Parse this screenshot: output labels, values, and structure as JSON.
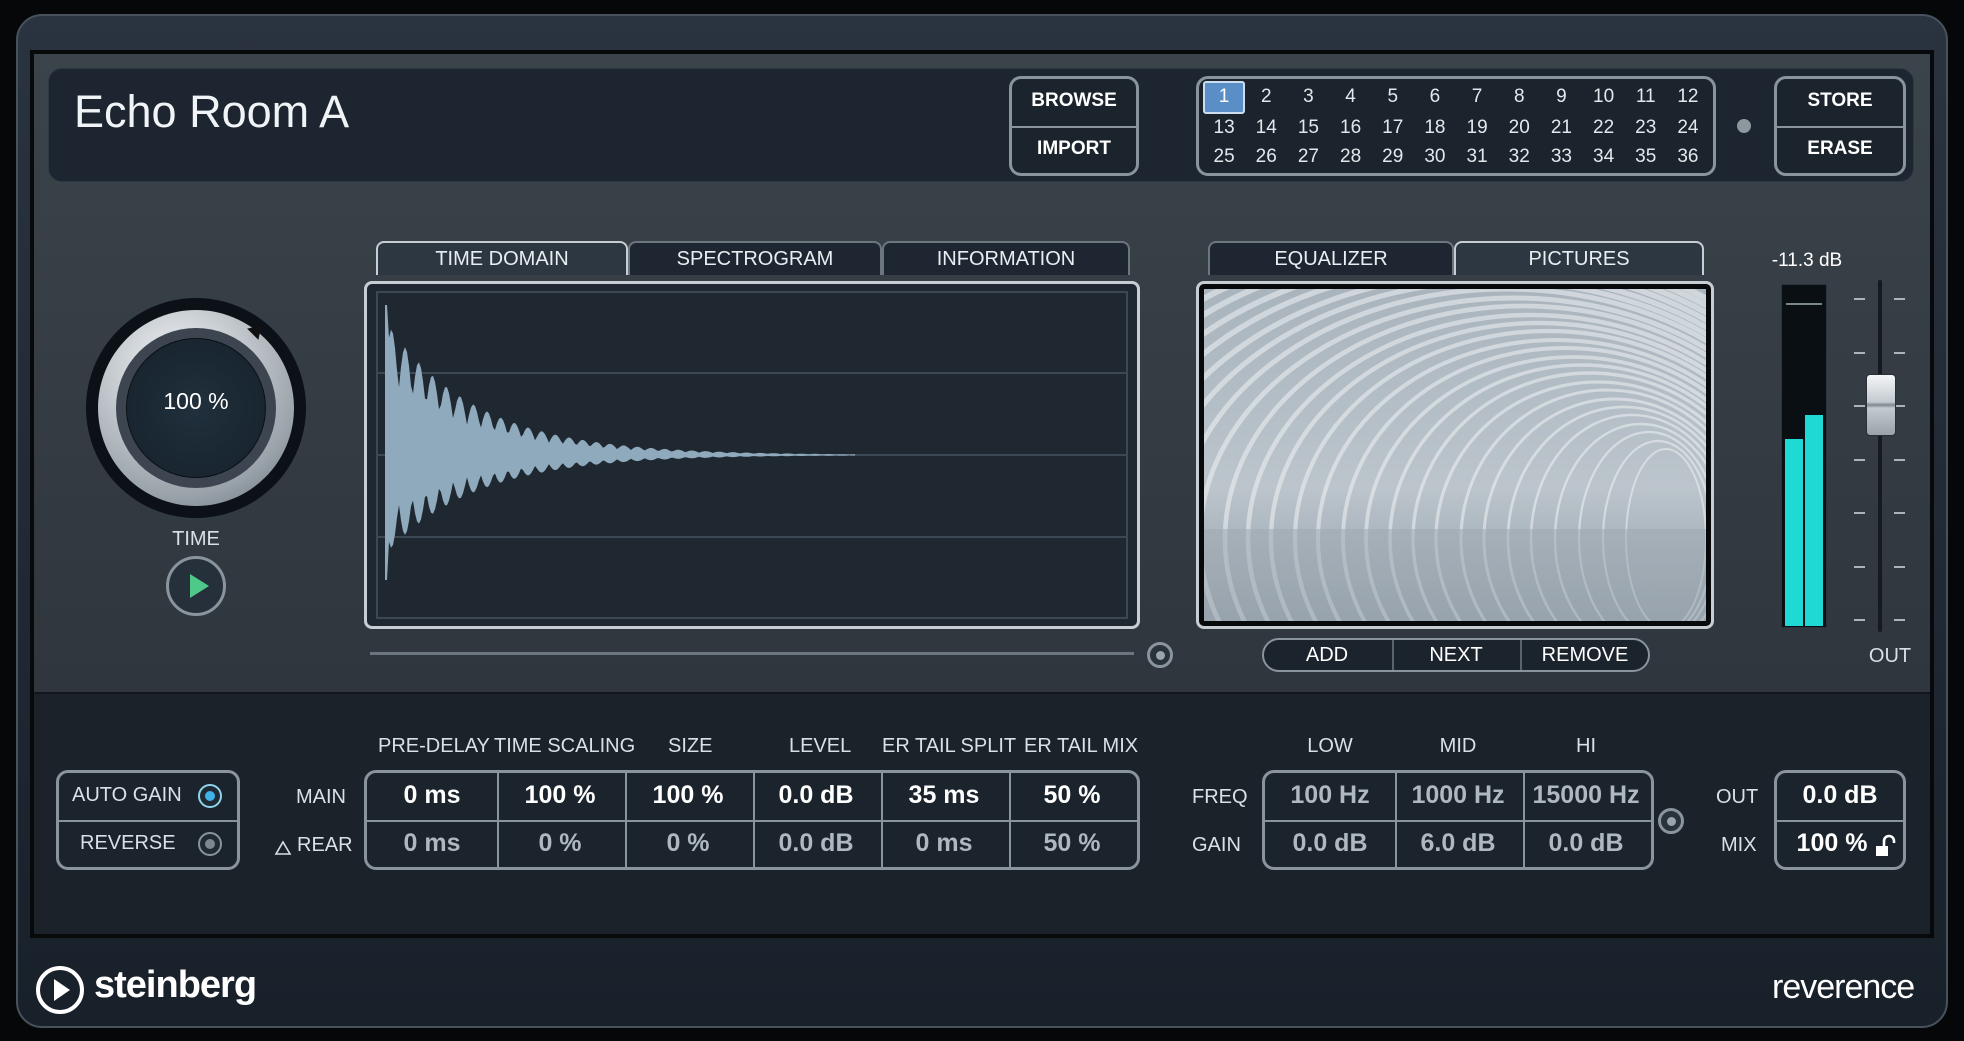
{
  "preset": {
    "name": "Echo Room A"
  },
  "buttons": {
    "browse": "BROWSE",
    "import": "IMPORT",
    "store": "STORE",
    "erase": "ERASE"
  },
  "slots": [
    "1",
    "2",
    "3",
    "4",
    "5",
    "6",
    "7",
    "8",
    "9",
    "10",
    "11",
    "12",
    "13",
    "14",
    "15",
    "16",
    "17",
    "18",
    "19",
    "20",
    "21",
    "22",
    "23",
    "24",
    "25",
    "26",
    "27",
    "28",
    "29",
    "30",
    "31",
    "32",
    "33",
    "34",
    "35",
    "36"
  ],
  "active_slot": "1",
  "time_knob": {
    "value": "100 %",
    "label": "TIME"
  },
  "display_tabs": [
    "TIME DOMAIN",
    "SPECTROGRAM",
    "INFORMATION"
  ],
  "picture_tabs": [
    "EQUALIZER",
    "PICTURES"
  ],
  "picture_buttons": [
    "ADD",
    "NEXT",
    "REMOVE"
  ],
  "meter": {
    "readout": "-11.3 dB",
    "label": "OUT",
    "left_level": 0.55,
    "right_level": 0.62
  },
  "bottom": {
    "auto_gain": "AUTO GAIN",
    "reverse": "REVERSE",
    "main": "MAIN",
    "rear": "REAR",
    "headers": [
      "PRE-DELAY",
      "TIME SCALING",
      "SIZE",
      "LEVEL",
      "ER TAIL SPLIT",
      "ER TAIL MIX"
    ],
    "main_values": [
      "0 ms",
      "100 %",
      "100 %",
      "0.0 dB",
      "35 ms",
      "50 %"
    ],
    "rear_values": [
      "0 ms",
      "0 %",
      "0 %",
      "0.0 dB",
      "0 ms",
      "50 %"
    ],
    "eq_headers": [
      "LOW",
      "MID",
      "HI"
    ],
    "freq_label": "FREQ",
    "gain_label": "GAIN",
    "freq_values": [
      "100 Hz",
      "1000 Hz",
      "15000 Hz"
    ],
    "gain_values": [
      "0.0 dB",
      "6.0 dB",
      "0.0 dB"
    ],
    "out_label": "OUT",
    "mix_label": "MIX",
    "out_value": "0.0 dB",
    "mix_value": "100 %"
  },
  "footer": {
    "brand": "steinberg",
    "product": "reverence"
  },
  "colors": {
    "accent": "#5a8ec7",
    "meter": "#1fd9d4",
    "waveform": "#8fa9bd"
  }
}
